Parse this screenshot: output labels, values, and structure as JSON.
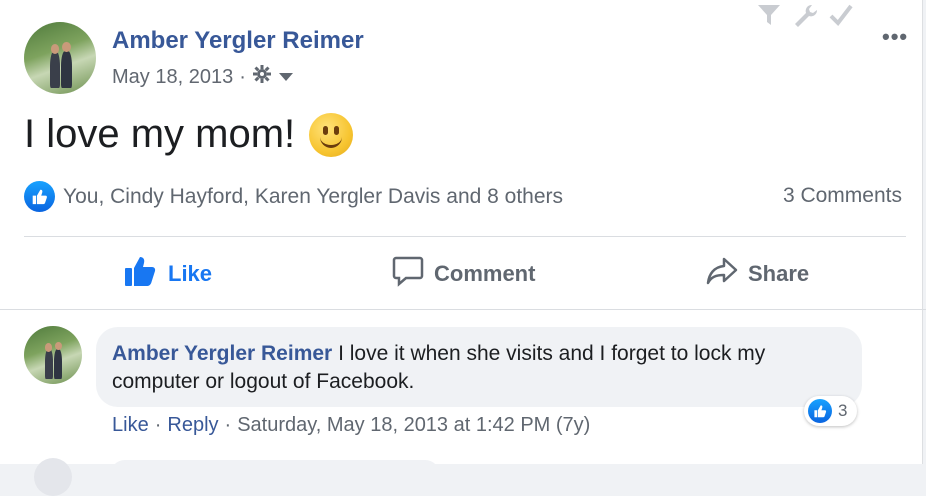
{
  "post": {
    "author": "Amber Yergler Reimer",
    "date": "May 18, 2013",
    "separator": "·",
    "text": "I love my mom!",
    "emoji": "slightly-smiling-face"
  },
  "reactions": {
    "summary": "You, Cindy Hayford, Karen Yergler Davis and 8 others",
    "comments_count": "3 Comments"
  },
  "actions": {
    "like": "Like",
    "comment": "Comment",
    "share": "Share"
  },
  "comment": {
    "author": "Amber Yergler Reimer",
    "text": "I love it when she visits and I forget to lock my computer or logout of Facebook.",
    "reaction_count": "3",
    "like_label": "Like",
    "reply_label": "Reply",
    "sep": "·",
    "timestamp": "Saturday, May 18, 2013 at 1:42 PM (7y)"
  },
  "colors": {
    "link": "#385898",
    "like_blue": "#1877f2",
    "muted": "#606770",
    "bubble": "#f0f2f5"
  }
}
